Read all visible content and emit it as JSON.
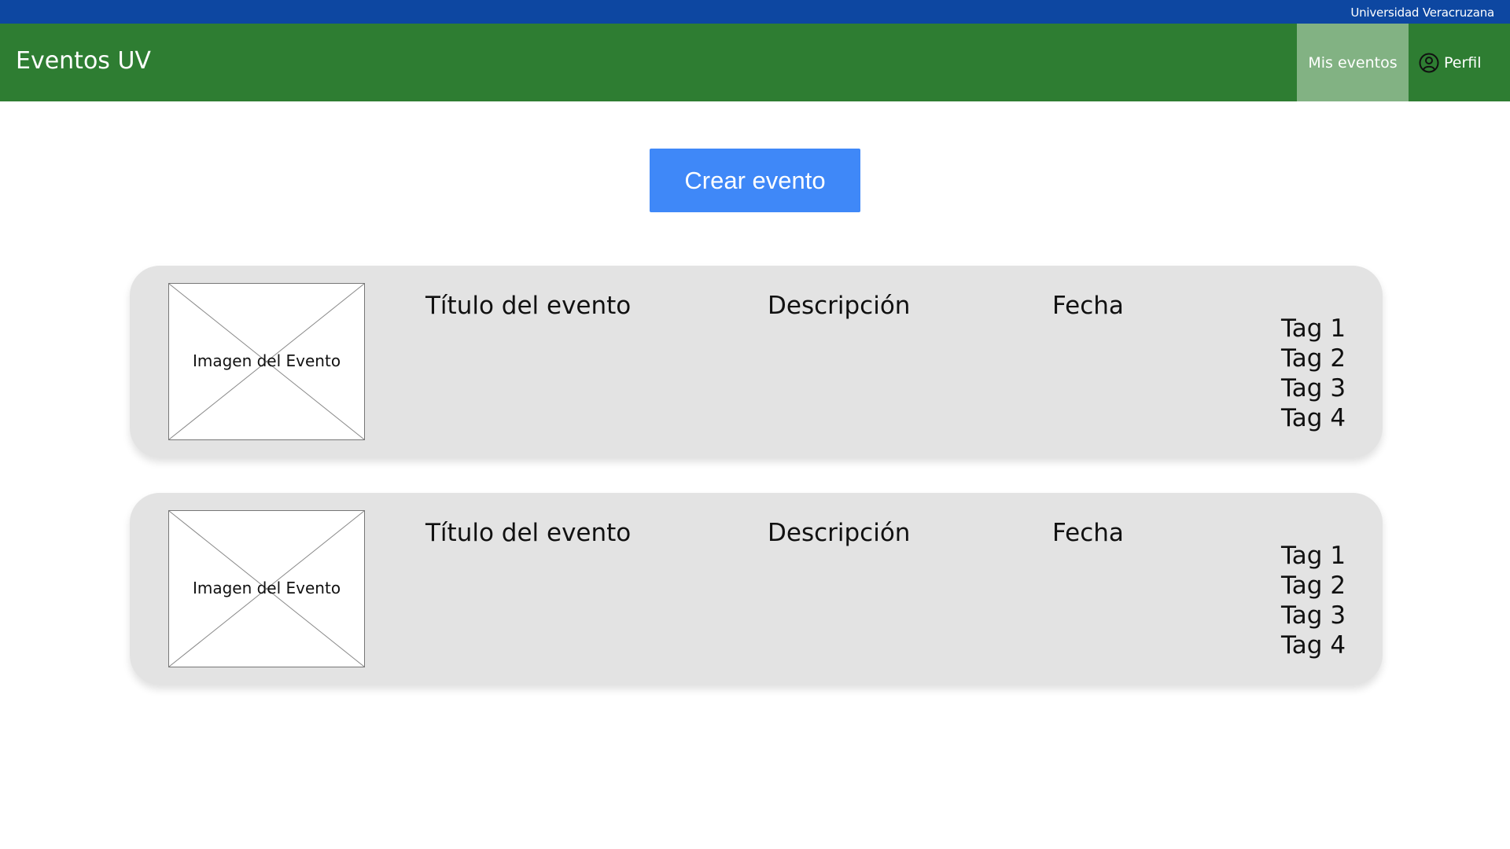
{
  "topbar": {
    "university": "Universidad Veracruzana",
    "color": "#0d47a1"
  },
  "navbar": {
    "brand": "Eventos UV",
    "color": "#2e7d32",
    "active_item_color": "#82b283",
    "items": [
      {
        "label": "Mis eventos",
        "active": true
      },
      {
        "label": "Perfil",
        "icon": "user-circle-icon",
        "active": false
      }
    ]
  },
  "main": {
    "create_button_label": "Crear evento",
    "create_button_color": "#3f88f8",
    "events": [
      {
        "image_label": "Imagen del Evento",
        "title": "Título del evento",
        "description": "Descripción",
        "date": "Fecha",
        "tags": [
          "Tag 1",
          "Tag 2",
          "Tag 3",
          "Tag 4"
        ]
      },
      {
        "image_label": "Imagen del Evento",
        "title": "Título del evento",
        "description": "Descripción",
        "date": "Fecha",
        "tags": [
          "Tag 1",
          "Tag 2",
          "Tag 3",
          "Tag 4"
        ]
      }
    ]
  }
}
